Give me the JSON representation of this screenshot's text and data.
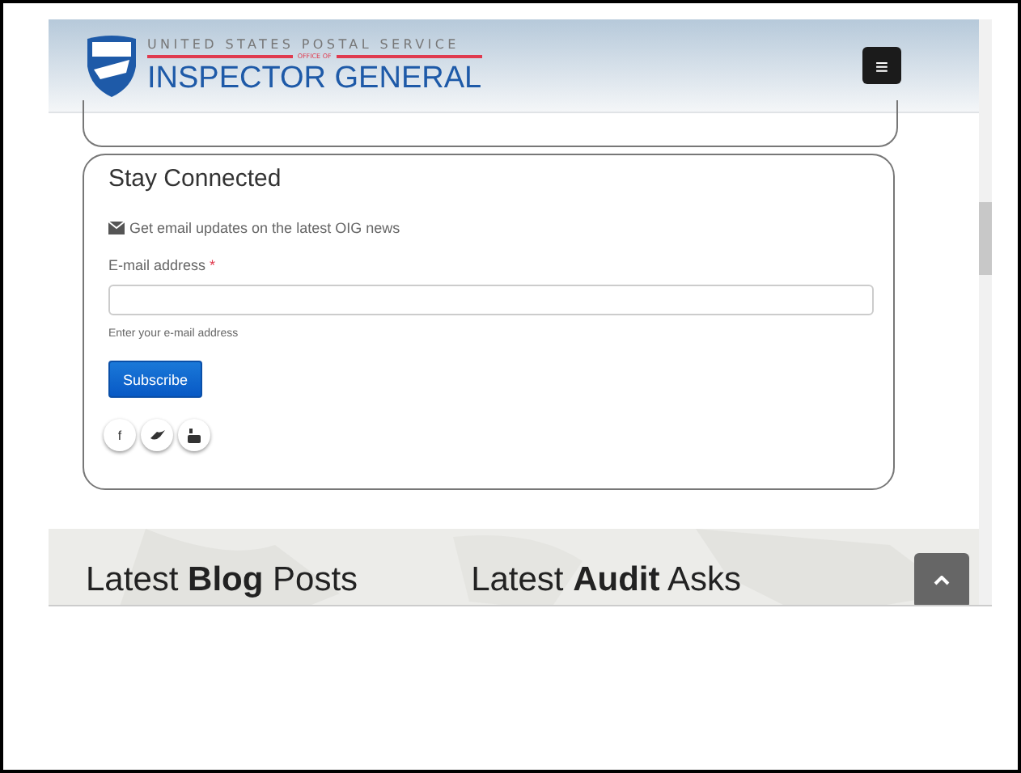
{
  "header": {
    "logo_top": "UNITED STATES POSTAL SERVICE",
    "logo_middle": "OFFICE OF",
    "logo_main": "INSPECTOR GENERAL",
    "menu_icon": "≡"
  },
  "signup": {
    "title": "Stay Connected",
    "intro": "Get email updates on the latest OIG news",
    "field_label": "E-mail address",
    "required_mark": "*",
    "help": "Enter your e-mail address",
    "button": "Subscribe",
    "social": [
      {
        "kind": "facebook",
        "label": "f"
      },
      {
        "kind": "twitter"
      },
      {
        "kind": "youtube"
      }
    ]
  },
  "latest": [
    "Latest **Blog** Posts",
    "Latest **Audit** Asks"
  ]
}
